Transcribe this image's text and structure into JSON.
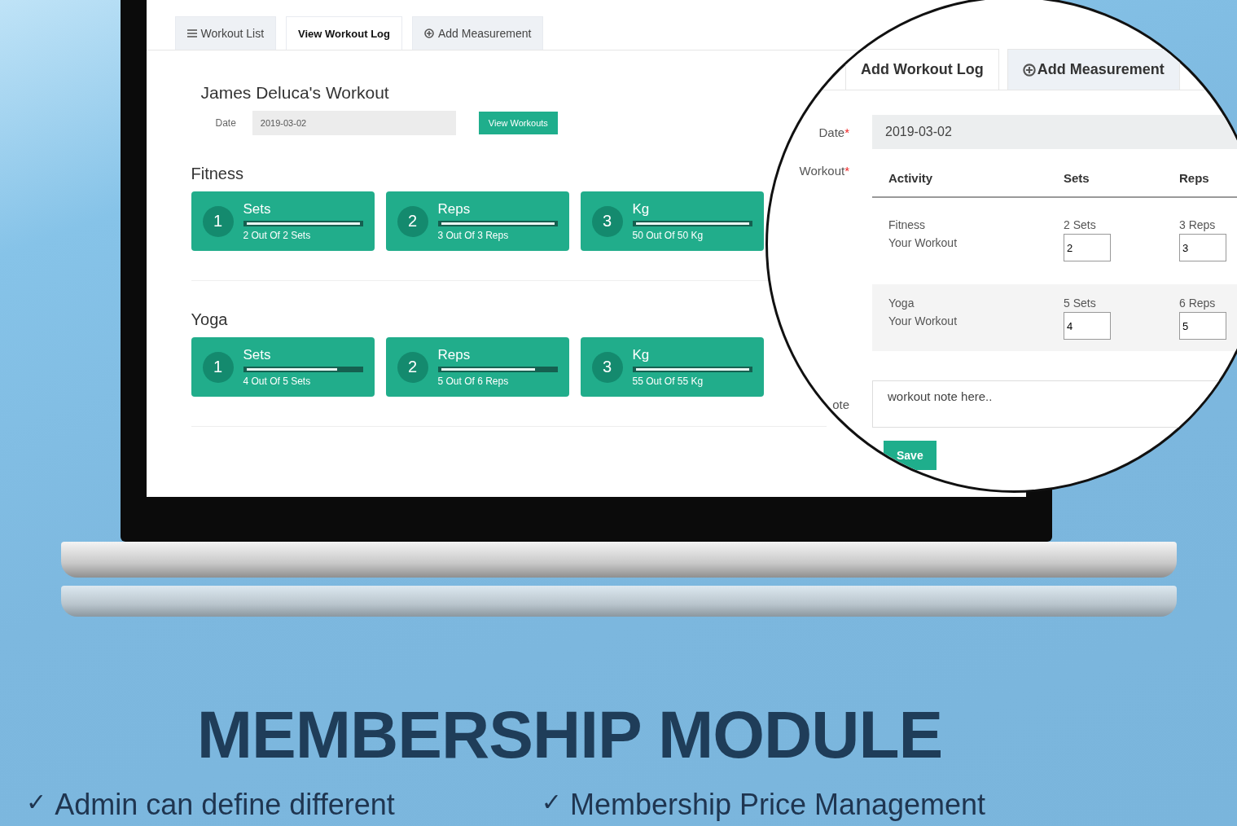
{
  "tabs": [
    {
      "label": "Workout List",
      "selected": false
    },
    {
      "label": "View Workout Log",
      "selected": true
    },
    {
      "label": "Add Measurement",
      "selected": false
    }
  ],
  "heading": "James Deluca's Workout",
  "date_field": {
    "label": "Date",
    "value": "2019-03-02"
  },
  "view_button": "View Workouts",
  "groups": [
    {
      "name": "Fitness",
      "stats": [
        {
          "number": "1",
          "title": "Sets",
          "level": 1,
          "caption": "2 Out Of 2 Sets"
        },
        {
          "number": "2",
          "title": "Reps",
          "level": 1,
          "caption": "3 Out Of 3 Reps"
        },
        {
          "number": "3",
          "title": "Kg",
          "level": 1,
          "caption": "50 Out Of 50 Kg"
        }
      ]
    },
    {
      "name": "Yoga",
      "stats": [
        {
          "number": "1",
          "title": "Sets",
          "level": 0.8,
          "caption": "4 Out Of 5 Sets"
        },
        {
          "number": "2",
          "title": "Reps",
          "level": 0.83,
          "caption": "5 Out Of 6 Reps"
        },
        {
          "number": "3",
          "title": "Kg",
          "level": 1,
          "caption": "55 Out Of 55 Kg"
        }
      ]
    }
  ],
  "magnifier": {
    "tabs": [
      {
        "label": "Add Workout Log",
        "selected": true
      },
      {
        "label": "Add Measurement",
        "selected": false
      }
    ],
    "date": {
      "label": "Date",
      "required_mark": "*",
      "value": "2019-03-02"
    },
    "workout_label": {
      "label": "Workout",
      "required_mark": "*"
    },
    "columns": [
      "Activity",
      "Sets",
      "Reps"
    ],
    "rows": [
      {
        "activity": "Fitness",
        "sub": "Your Workout",
        "sets_target": "2 Sets",
        "sets_value": "2",
        "reps_target": "3 Reps",
        "reps_value": "3"
      },
      {
        "activity": "Yoga",
        "sub": "Your Workout",
        "sets_target": "5 Sets",
        "sets_value": "4",
        "reps_target": "6 Reps",
        "reps_value": "5"
      }
    ],
    "note_label": "ote",
    "note_placeholder": "workout note here..",
    "save_button": "Save"
  },
  "title": "MEMBERSHIP MODULE",
  "bullets": [
    {
      "mark": "✓",
      "text": "Admin can define different"
    },
    {
      "mark": "✓",
      "text": "Membership Price Management"
    }
  ]
}
